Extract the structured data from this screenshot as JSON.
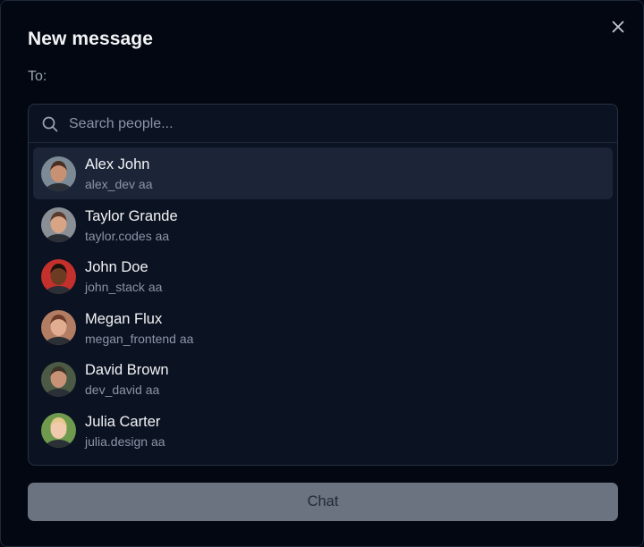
{
  "dialog": {
    "title": "New message",
    "to_label": "To:",
    "close_icon": "close-icon"
  },
  "search": {
    "placeholder": "Search people...",
    "value": "",
    "icon": "search-icon"
  },
  "people": [
    {
      "name": "Alex John",
      "handle": "alex_dev aa",
      "selected": true,
      "avatar_skin": "#c99174",
      "avatar_hair": "#4a2f22",
      "avatar_bg": "#7c8a96"
    },
    {
      "name": "Taylor Grande",
      "handle": "taylor.codes aa",
      "selected": false,
      "avatar_skin": "#d7a585",
      "avatar_hair": "#5a3b2c",
      "avatar_bg": "#8a8f96"
    },
    {
      "name": "John Doe",
      "handle": "john_stack aa",
      "selected": false,
      "avatar_skin": "#6b3c22",
      "avatar_hair": "#1c120c",
      "avatar_bg": "#c4302b"
    },
    {
      "name": "Megan Flux",
      "handle": "megan_frontend aa",
      "selected": false,
      "avatar_skin": "#e0ad90",
      "avatar_hair": "#6e3a2a",
      "avatar_bg": "#b27d63"
    },
    {
      "name": "David Brown",
      "handle": "dev_david aa",
      "selected": false,
      "avatar_skin": "#c89277",
      "avatar_hair": "#3d3326",
      "avatar_bg": "#4b5a44"
    },
    {
      "name": "Julia Carter",
      "handle": "julia.design aa",
      "selected": false,
      "avatar_skin": "#f1c9ad",
      "avatar_hair": "#e3c98a",
      "avatar_bg": "#6f9a4e"
    }
  ],
  "actions": {
    "chat_label": "Chat",
    "chat_enabled": false
  },
  "colors": {
    "background": "#030712",
    "panel": "#0b1221",
    "selected_row": "#1b2537",
    "button_disabled": "#6b7280"
  }
}
